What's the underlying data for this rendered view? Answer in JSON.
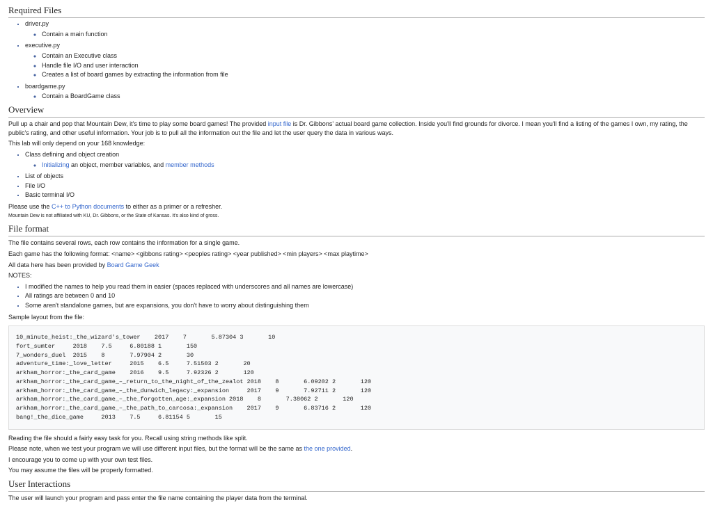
{
  "sections": {
    "required_files": {
      "heading": "Required Files",
      "items": [
        {
          "name": "driver.py",
          "sub": [
            "Contain a main function"
          ]
        },
        {
          "name": "executive.py",
          "sub": [
            "Contain an Executive class",
            "Handle file I/O and user interaction",
            "Creates a list of board games by extracting the information from file"
          ]
        },
        {
          "name": "boardgame.py",
          "sub": [
            "Contain a BoardGame class"
          ]
        }
      ]
    },
    "overview": {
      "heading": "Overview",
      "intro_before": "Pull up a chair and pop that Mountain Dew, it's time to play some board games! The provided ",
      "intro_link": "input file",
      "intro_after": " is Dr. Gibbons' actual board game collection. Inside you'll find grounds for divorce. I mean you'll find a listing of the games I own, my rating, the public's rating, and other useful information. Your job is to pull all the information out the file and let the user query the data in various ways.",
      "depend": "This lab will only depend on your 168 knowledge:",
      "items": [
        {
          "text_before": "Class defining and object creation",
          "sub_before": "Initializing",
          "sub_mid": " an object, member variables, and ",
          "sub_link": "member methods"
        },
        "List of objects",
        "File I/O",
        "Basic terminal I/O"
      ],
      "please_before": "Please use the ",
      "please_link": "C++ to Python documents",
      "please_after": " to either as a primer or a refresher.",
      "fineprint": "Mountain Dew is not affiliated with KU, Dr. Gibbons, or the State of Kansas. It's also kind of gross."
    },
    "fileformat": {
      "heading": "File format",
      "line1": "The file contains several rows, each row contains the information for a single game.",
      "line2": "Each game has the following format: <name>  <gibbons rating>  <peoples rating>  <year published>  <min players>  <max playtime>",
      "line3_before": "All data here has been provided by ",
      "line3_link": "Board Game Geek",
      "notes_label": "NOTES:",
      "notes": [
        "I modified the names to help you read them in easier (spaces replaced with underscores and all names are lowercase)",
        "All ratings are between 0 and 10",
        "Some aren't standalone games, but are expansions, you don't have to worry about distinguishing them"
      ],
      "sample_label": "Sample layout from the file:",
      "sample": "10_minute_heist:_the_wizard's_tower    2017    7       5.87304 3       10\nfort_sumter     2018    7.5     6.80188 1       150\n7_wonders_duel  2015    8       7.97904 2       30\nadventure_time:_love_letter     2015    6.5     7.51503 2       20\narkham_horror:_the_card_game    2016    9.5     7.92326 2       120\narkham_horror:_the_card_game_–_return_to_the_night_of_the_zealot 2018    8       6.09202 2       120\narkham_horror:_the_card_game_–_the_dunwich_legacy:_expansion     2017    9       7.92711 2       120\narkham_horror:_the_card_game_–_the_forgotten_age:_expansion 2018    8       7.38062 2       120\narkham_horror:_the_card_game_–_the_path_to_carcosa:_expansion    2017    9       6.83716 2       120\nbang!_the_dice_game     2013    7.5     6.81154 5       15",
      "reading": "Reading the file should a fairly easy task for you. Recall using string methods like split.",
      "pleasenote_before": "Please note, when we test your program we will use different input files, but the format will be the same as ",
      "pleasenote_link": "the one provided",
      "pleasenote_after": ".",
      "encourage": "I encourage you to come up with your own test files.",
      "assume": "You may assume the files will be properly formatted."
    },
    "userinteractions": {
      "heading": "User Interactions",
      "line": "The user will launch your program and pass enter the file name containing the player data from the terminal."
    }
  }
}
